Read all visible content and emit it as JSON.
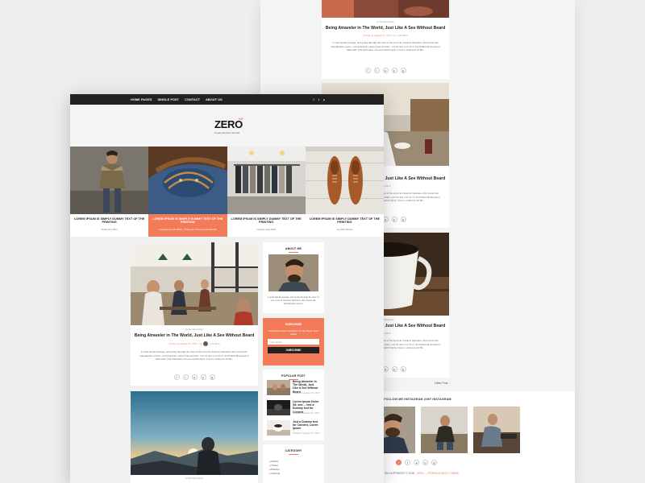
{
  "back": {
    "top_post": {
      "category": "In Relationship",
      "title": "Being Atraveler in The World, Just Like A See Without Beard",
      "meta_posted": "Posted on August 07, 2017",
      "meta_by": "by",
      "meta_author": "Cole Mon",
      "excerpt": "Lorem Ipsum passage, and going through the cites of the word in classical literature, discovered the undoubtable source. Lorem Ipsum comes from sections 1.10.32 and 1.10.33 of 'de Finibus Bonorum et Malorum' (The Extremes of Good and Evil) by Cicero, written in 45 BC."
    },
    "mid_post": {
      "title": "Being Atraveler in The World, Just Like A See Without Beard",
      "meta_author": "Cole Mon",
      "excerpt": "Lorem Ipsum passage, and going through the cites of the word in classical literature, discovered the undoubtable source. Lorem Ipsum comes from sections 1.10.32 and 1.10.33 of 'de Finibus Bonorum et Malorum' (The Extremes of Good and Evil) by Cicero, written in 45 BC."
    },
    "third_post": {
      "category": "In Relationship",
      "title": "Being Atraveler in The World, Just Like A See Without Beard",
      "meta_author": "Cole Mon",
      "excerpt": "Lorem Ipsum passage, and going through the cites of the word in classical literature, discovered the undoubtable source. Lorem Ipsum comes from sections 1.10.32 and 1.10.33 of 'de Finibus Bonorum et Malorum' (The Extremes of Good and Evil) by Cicero, written in 45 BC."
    },
    "older_link": "Older Post",
    "older_arrow": "→",
    "follow_title": "FOLLOW ME INSTAGRAM @MY INSTAGRAM",
    "copyright_prefix": "ZERO KM COPYRIGHT © 2018 ·",
    "copyright_link": "ZERO — PREMIUM BLOG THEME"
  },
  "nav": {
    "items": [
      "HOME PAGES",
      "SINGLE POST",
      "CONTACT",
      "ABOUT US"
    ],
    "social": [
      "f",
      "t",
      "p"
    ]
  },
  "brand": {
    "logo": "ZERO",
    "superscript": "KM",
    "tagline": "Create, Review and tell"
  },
  "slides": [
    {
      "title": "LOREM IPSUM IS SIMPLY DUMMY TEXT OF THE PRINTING",
      "sub": "Jasdk Dest Here"
    },
    {
      "title": "LOREM IPSUM IS SIMPLY DUMMY TEXT OF THE PRINTING",
      "sub": "Jasdj Dasda Sdv Hhdn_ Fliip and Timana partbbipntiiin"
    },
    {
      "title": "LOREM IPSUM IS SIMPLY DUMMY TEXT OF THE PRINTING",
      "sub": "Thajsay Jasd Hede"
    },
    {
      "title": "LOREM IPSUM IS SIMPLY DUMMY TEXT OF THE PRINTING",
      "sub": "Lordbol Hasds"
    }
  ],
  "main_post": {
    "category": "In Relationship",
    "title": "Being Atraveler in The World, Just Like A See Without Beard",
    "meta_posted": "Posted on August 07, 2017",
    "meta_by": "by",
    "meta_author": "Cole Mon",
    "excerpt": "Lorem Ipsum passage, and going through the cites of the word in classical literature, discovered the undoubtable source. Lorem Ipsum comes from sections 1.10.32 and 1.10.33 of 'de Finibus Bonorum et Malorum' (The Extremes of Good and Evil) by Cicero, written in 45 BC."
  },
  "second_post": {
    "category": "In Relationship"
  },
  "sidebar": {
    "about_title": "ABOUT ME",
    "about_text": "Lorem Ipsum passage, and going through the cites of the word in classical literature, discovered the undoubtable source.",
    "subscribe_title": "SUBSCRIBE",
    "subscribe_text": "Subscribe to this newsletter for the latest news about",
    "email_placeholder": "Your Email",
    "subscribe_button": "SUBSCRIBE",
    "popular_title": "POPULAR POST",
    "popular": [
      {
        "title": "Being Atraveler in The World, Just Like A See Without Beard",
        "date": "Posted on August 07, 2017"
      },
      {
        "title": "Lorem Ipsum Dolor Sit, sed ... test a Dummy text for Content",
        "date": "Posted on August 07, 2017"
      },
      {
        "title": "Just a Dummy text for Content, Lorem Ipsum",
        "date": "Posted on August 07, 2017"
      }
    ],
    "category_title": "CATEGORY",
    "categories": [
      "Nature",
      "Travel",
      "Fashion",
      "Lifestyle"
    ]
  },
  "colors": {
    "accent": "#f47b5a",
    "topbar": "#222222",
    "background": "#eeeeee"
  }
}
